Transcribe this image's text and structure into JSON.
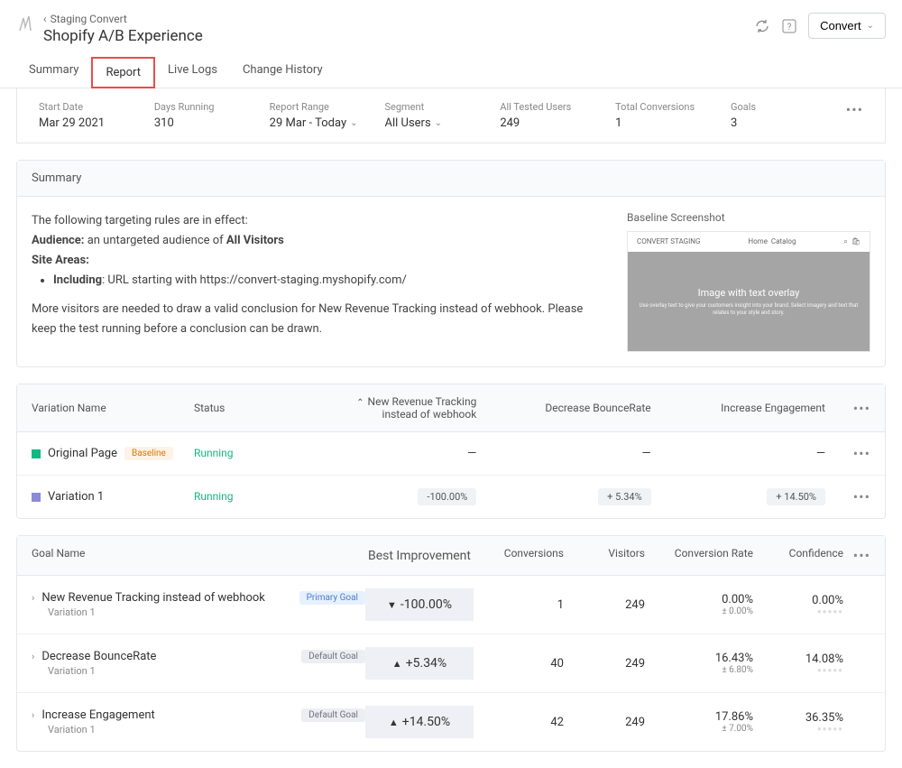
{
  "breadcrumb": "Staging Convert",
  "page_title": "Shopify A/B Experience",
  "header_button": "Convert",
  "tabs": [
    "Summary",
    "Report",
    "Live Logs",
    "Change History"
  ],
  "active_tab": 1,
  "stats": {
    "start_date": {
      "label": "Start Date",
      "value": "Mar 29 2021"
    },
    "days_running": {
      "label": "Days Running",
      "value": "310"
    },
    "report_range": {
      "label": "Report Range",
      "value": "29 Mar - Today"
    },
    "segment": {
      "label": "Segment",
      "value": "All Users"
    },
    "tested_users": {
      "label": "All Tested Users",
      "value": "249"
    },
    "total_conversions": {
      "label": "Total Conversions",
      "value": "1"
    },
    "goals": {
      "label": "Goals",
      "value": "3"
    }
  },
  "summary": {
    "title": "Summary",
    "intro": "The following targeting rules are in effect:",
    "audience_label": "Audience:",
    "audience_text": " an untargeted audience of ",
    "audience_value": "All Visitors",
    "site_areas_label": "Site Areas:",
    "including_label": "Including",
    "including_text": ": URL starting with ",
    "including_url": "https://convert-staging.myshopify.com/",
    "conclusion": "More visitors are needed to draw a valid conclusion for New Revenue Tracking instead of webhook. Please keep the test running before a conclusion can be drawn.",
    "screenshot_label": "Baseline Screenshot",
    "ss_brand": "CONVERT STAGING",
    "ss_nav1": "Home",
    "ss_nav2": "Catalog",
    "ss_hero_title": "Image with text overlay",
    "ss_hero_sub": "Use overlay text to give your customers insight into your brand. Select imagery and text that relates to your style and story."
  },
  "var_headers": {
    "name": "Variation Name",
    "status": "Status",
    "metric1": "New Revenue Tracking instead of webhook",
    "metric2": "Decrease BounceRate",
    "metric3": "Increase Engagement"
  },
  "variations": [
    {
      "name": "Original Page",
      "color": "green",
      "badge": "Baseline",
      "status": "Running",
      "m1": "—",
      "m2": "—",
      "m3": "—",
      "pill": false
    },
    {
      "name": "Variation 1",
      "color": "purple",
      "badge": "",
      "status": "Running",
      "m1": "-100.00%",
      "m2": "+ 5.34%",
      "m3": "+ 14.50%",
      "pill": true
    }
  ],
  "goal_headers": {
    "name": "Goal Name",
    "improve": "Best Improvement",
    "conv": "Conversions",
    "vis": "Visitors",
    "rate": "Conversion Rate",
    "conf": "Confidence"
  },
  "goals": [
    {
      "name": "New Revenue Tracking instead of webhook",
      "sub": "Variation 1",
      "badge": "Primary Goal",
      "badge_class": "badge-primary",
      "dir": "down",
      "improve": "-100.00%",
      "conv": "1",
      "vis": "249",
      "rate": "0.00%",
      "rate_sub": "± 0.00%",
      "conf": "0.00%"
    },
    {
      "name": "Decrease BounceRate",
      "sub": "Variation 1",
      "badge": "Default Goal",
      "badge_class": "badge-default",
      "dir": "up",
      "improve": "+5.34%",
      "conv": "40",
      "vis": "249",
      "rate": "16.43%",
      "rate_sub": "± 6.80%",
      "conf": "14.08%"
    },
    {
      "name": "Increase Engagement",
      "sub": "Variation 1",
      "badge": "Default Goal",
      "badge_class": "badge-default",
      "dir": "up",
      "improve": "+14.50%",
      "conv": "42",
      "vis": "249",
      "rate": "17.86%",
      "rate_sub": "± 7.00%",
      "conf": "36.35%"
    }
  ]
}
